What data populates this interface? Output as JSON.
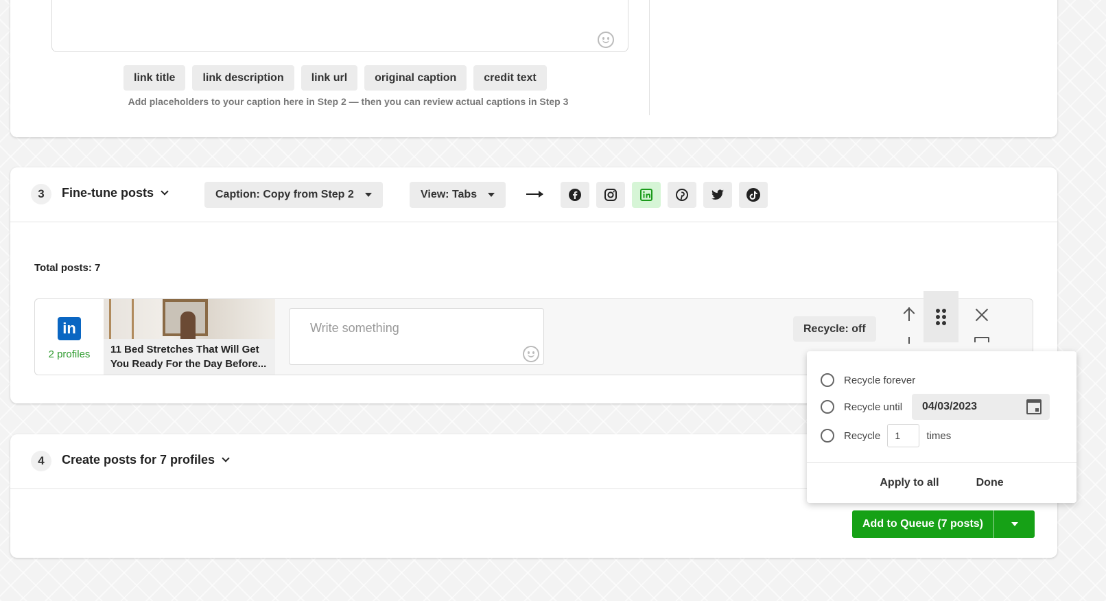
{
  "step2": {
    "placeholders": [
      "link title",
      "link description",
      "link url",
      "original caption",
      "credit text"
    ],
    "hint": "Add placeholders to your caption here in Step 2 — then you can review actual captions in Step 3"
  },
  "step3": {
    "number": "3",
    "title": "Fine-tune posts",
    "caption_dropdown": "Caption: Copy from Step 2",
    "view_dropdown": "View: Tabs",
    "networks": [
      {
        "name": "facebook",
        "active": false
      },
      {
        "name": "instagram",
        "active": false
      },
      {
        "name": "linkedin",
        "active": true
      },
      {
        "name": "pinterest",
        "active": false
      },
      {
        "name": "twitter",
        "active": false
      },
      {
        "name": "tiktok",
        "active": false
      }
    ],
    "total_posts": "Total posts: 7",
    "post": {
      "network_icon": "linkedin-icon",
      "profiles": "2 profiles",
      "title": "11 Bed Stretches That Will Get You Ready For the Day Before...",
      "write_placeholder": "Write something",
      "recycle_label": "Recycle: off"
    }
  },
  "step4": {
    "number": "4",
    "title": "Create posts for 7 profiles",
    "queue_button": "Add to Queue (7 posts)"
  },
  "recycle_popup": {
    "forever": "Recycle forever",
    "until": "Recycle until",
    "until_date": "04/03/2023",
    "recycle": "Recycle",
    "times_value": "1",
    "times": "times",
    "apply_all": "Apply to all",
    "done": "Done"
  },
  "colors": {
    "accent_green": "#16a116",
    "linkedin_blue": "#0a66c2",
    "profiles_green": "#2f9b2f"
  }
}
